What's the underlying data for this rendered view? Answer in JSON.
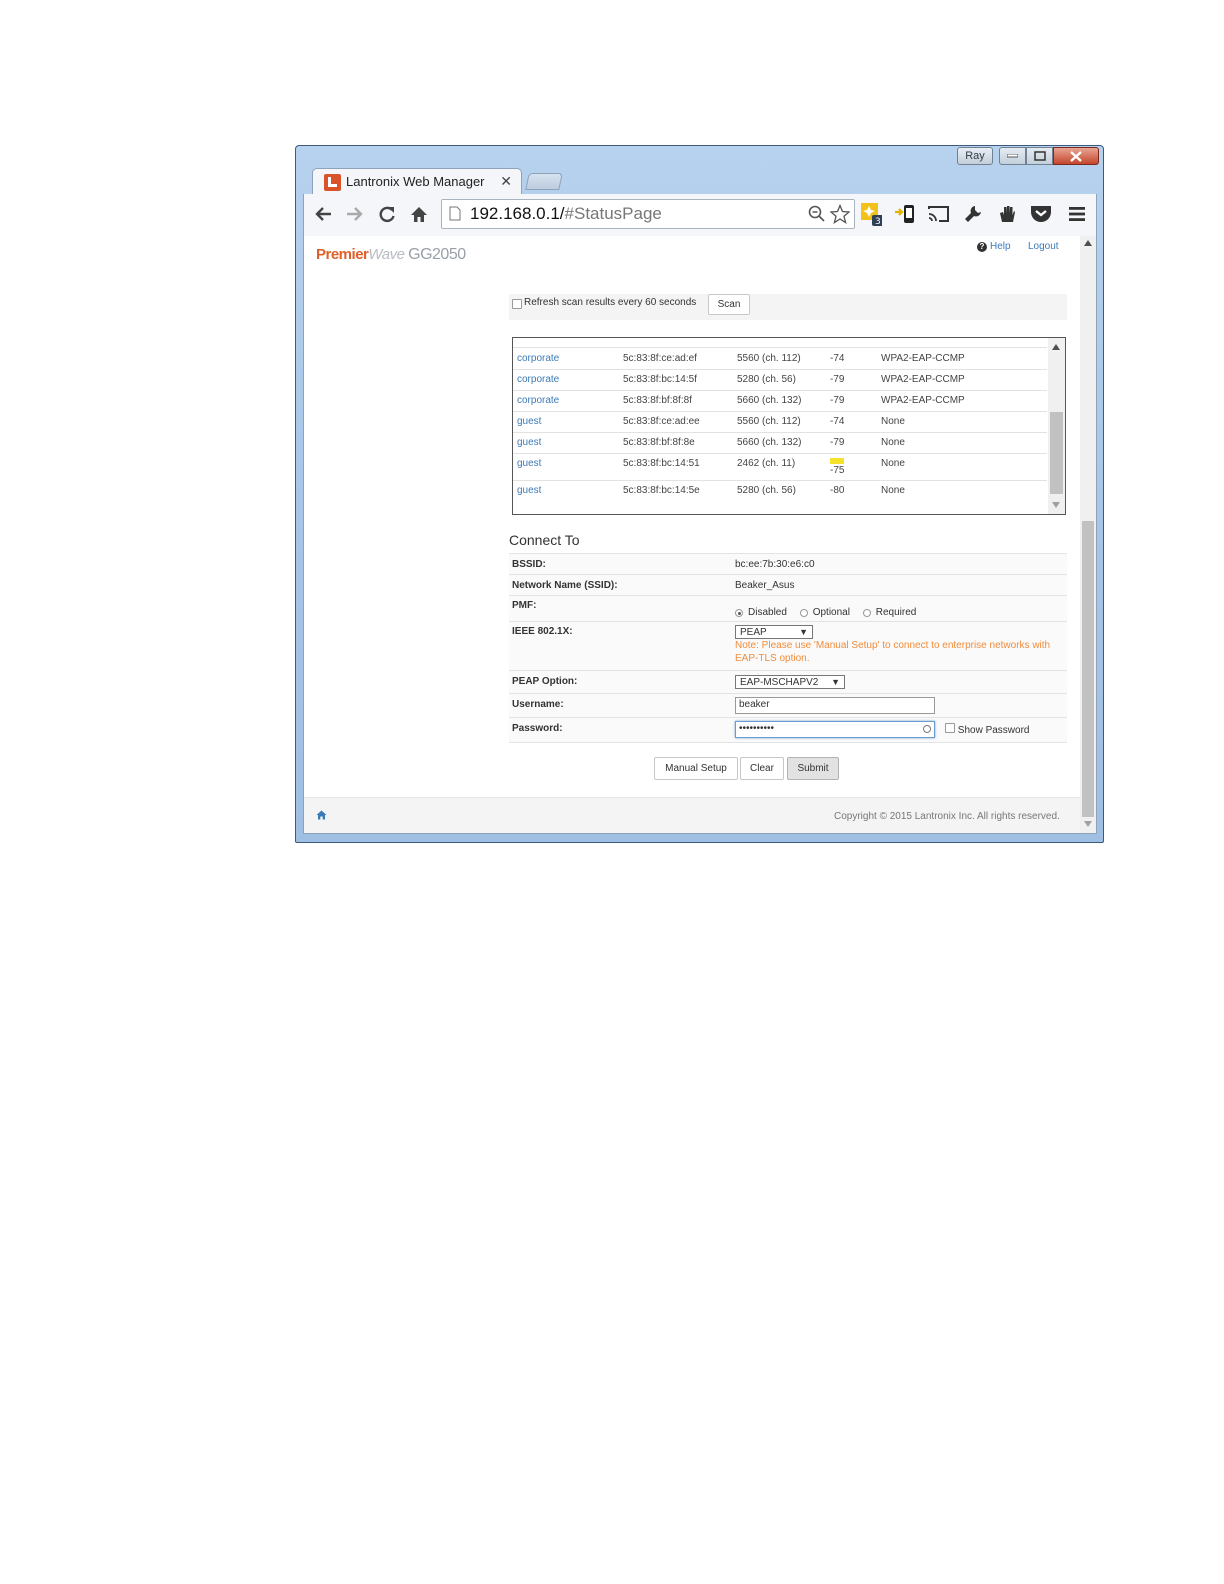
{
  "window": {
    "user": "Ray",
    "tab_title": "Lantronix Web Manager",
    "url_host": "192.168.0.1/",
    "url_path": "#StatusPage"
  },
  "header": {
    "brand_part1": "Premier",
    "brand_part2": "Wave",
    "brand_part3": "GG2050",
    "help": "Help",
    "logout": "Logout"
  },
  "scan": {
    "refresh_label": "Refresh scan results every 60 seconds",
    "scan_button": "Scan"
  },
  "results": [
    {
      "ssid": "corporate",
      "bssid": "5c:83:8f:ce:ad:ef",
      "freq": "5560 (ch. 112)",
      "rssi": "-74",
      "security": "WPA2-EAP-CCMP"
    },
    {
      "ssid": "corporate",
      "bssid": "5c:83:8f:bc:14:5f",
      "freq": "5280 (ch. 56)",
      "rssi": "-79",
      "security": "WPA2-EAP-CCMP"
    },
    {
      "ssid": "corporate",
      "bssid": "5c:83:8f:bf:8f:8f",
      "freq": "5660 (ch. 132)",
      "rssi": "-79",
      "security": "WPA2-EAP-CCMP"
    },
    {
      "ssid": "guest",
      "bssid": "5c:83:8f:ce:ad:ee",
      "freq": "5560 (ch. 112)",
      "rssi": "-74",
      "security": "None"
    },
    {
      "ssid": "guest",
      "bssid": "5c:83:8f:bf:8f:8e",
      "freq": "5660 (ch. 132)",
      "rssi": "-79",
      "security": "None"
    },
    {
      "ssid": "guest",
      "bssid": "5c:83:8f:bc:14:51",
      "freq": "2462 (ch. 11)",
      "rssi": "-75",
      "security": "None"
    },
    {
      "ssid": "guest",
      "bssid": "5c:83:8f:bc:14:5e",
      "freq": "5280 (ch. 56)",
      "rssi": "-80",
      "security": "None"
    }
  ],
  "connect": {
    "title": "Connect To",
    "bssid_label": "BSSID:",
    "bssid_value": "bc:ee:7b:30:e6:c0",
    "ssid_label": "Network Name (SSID):",
    "ssid_value": "Beaker_Asus",
    "pmf_label": "PMF:",
    "pmf_options": [
      "Disabled",
      "Optional",
      "Required"
    ],
    "pmf_selected": "Disabled",
    "ieee_label": "IEEE 802.1X:",
    "ieee_value": "PEAP",
    "ieee_note": "Note: Please use 'Manual Setup' to connect to enterprise networks with EAP-TLS option.",
    "peap_label": "PEAP Option:",
    "peap_value": "EAP-MSCHAPV2",
    "username_label": "Username:",
    "username_value": "beaker",
    "password_label": "Password:",
    "password_value": "••••••••••",
    "show_password": "Show Password"
  },
  "buttons": {
    "manual_setup": "Manual Setup",
    "clear": "Clear",
    "submit": "Submit"
  },
  "footer": {
    "copyright": "Copyright © 2015 Lantronix Inc. All rights reserved."
  }
}
